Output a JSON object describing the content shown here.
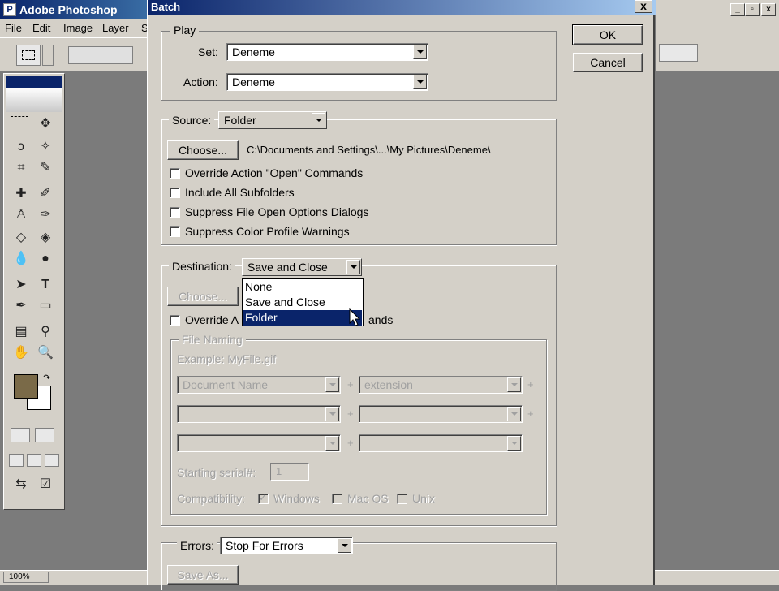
{
  "app": {
    "title": "Adobe Photoshop",
    "logo_glyph": "P",
    "menu": [
      "File",
      "Edit",
      "Image",
      "Layer",
      "S"
    ],
    "sys_buttons": [
      "_",
      "▫",
      "x"
    ],
    "status_zoom": "100%"
  },
  "dialog": {
    "title": "Batch",
    "close_label": "x",
    "ok_label": "OK",
    "cancel_label": "Cancel",
    "play": {
      "legend": "Play",
      "set_label": "Set:",
      "set_value": "Deneme",
      "action_label": "Action:",
      "action_value": "Deneme"
    },
    "source": {
      "label": "Source:",
      "value": "Folder",
      "choose_label": "Choose...",
      "path": "C:\\Documents and Settings\\...\\My Pictures\\Deneme\\",
      "options": [
        {
          "label": "Override Action \"Open\" Commands",
          "checked": false
        },
        {
          "label": "Include All Subfolders",
          "checked": false
        },
        {
          "label": "Suppress File Open Options Dialogs",
          "checked": false
        },
        {
          "label": "Suppress Color Profile Warnings",
          "checked": false
        }
      ]
    },
    "destination": {
      "label": "Destination:",
      "value": "Save and Close",
      "choose_label": "Choose...",
      "override_label": "Override A",
      "override_suffix": "ands",
      "dropdown_options": [
        "None",
        "Save and Close",
        "Folder"
      ],
      "highlighted_option": "Folder"
    },
    "file_naming": {
      "legend": "File Naming",
      "example": "Example: MyFile.gif",
      "field1": "Document Name",
      "field2": "extension",
      "plus": "+",
      "serial_label": "Starting serial#:",
      "serial_value": "1",
      "compat_label": "Compatibility:",
      "compat": [
        {
          "label": "Windows",
          "checked": true
        },
        {
          "label": "Mac OS",
          "checked": false
        },
        {
          "label": "Unix",
          "checked": false
        }
      ]
    },
    "errors": {
      "label": "Errors:",
      "value": "Stop For Errors",
      "save_as_label": "Save As..."
    }
  }
}
